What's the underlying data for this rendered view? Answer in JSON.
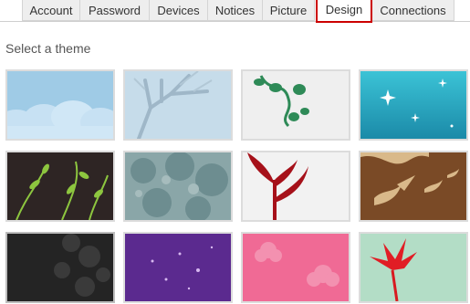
{
  "tabs": [
    {
      "label": "Account"
    },
    {
      "label": "Password"
    },
    {
      "label": "Devices"
    },
    {
      "label": "Notices"
    },
    {
      "label": "Picture"
    },
    {
      "label": "Design",
      "active": true
    },
    {
      "label": "Connections"
    }
  ],
  "section_title": "Select a theme",
  "themes": [
    {
      "name": "clouds"
    },
    {
      "name": "tree"
    },
    {
      "name": "swirl"
    },
    {
      "name": "sparkles"
    },
    {
      "name": "vines"
    },
    {
      "name": "foliage"
    },
    {
      "name": "plant"
    },
    {
      "name": "birds"
    },
    {
      "name": "dark"
    },
    {
      "name": "purple-stars"
    },
    {
      "name": "pink-flowers"
    },
    {
      "name": "red-leaf"
    }
  ],
  "colors": {
    "active_tab_border": "#cc0000",
    "tab_bg": "#eeeeee"
  }
}
